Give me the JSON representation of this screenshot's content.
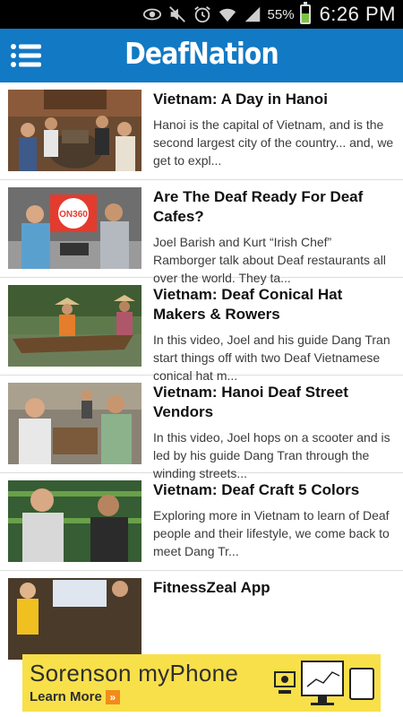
{
  "status_bar": {
    "battery_percent": "55%",
    "battery_level": 0.55,
    "time": "6:26 PM",
    "icons": [
      "eye-icon",
      "mute-icon",
      "alarm-icon",
      "wifi-icon",
      "signal-icon",
      "battery-icon"
    ]
  },
  "app_bar": {
    "title": "DeafNation",
    "menu_icon": "hamburger-menu-icon",
    "color": "#1279c4"
  },
  "articles": [
    {
      "title": "Vietnam: A Day in Hanoi",
      "description": "Hanoi is the capital of Vietnam, and is the second largest city of the country... and, we get to expl..."
    },
    {
      "title": "Are The Deaf Ready For Deaf Cafes?",
      "description": "Joel Barish and Kurt “Irish Chef” Ramborger talk about Deaf restaurants all over the world. They ta...",
      "thumb_text": "ON360"
    },
    {
      "title": "Vietnam: Deaf Conical Hat Makers & Rowers",
      "description": "In this video, Joel and his guide Dang Tran start things off with two Deaf Vietnamese conical hat m..."
    },
    {
      "title": "Vietnam: Hanoi Deaf Street Vendors",
      "description": "In this video, Joel hops on a scooter and is led by his guide Dang Tran through the winding streets..."
    },
    {
      "title": "Vietnam: Deaf Craft 5 Colors",
      "description": "Exploring more in Vietnam to learn of Deaf people and their lifestyle, we come back to meet Dang Tr..."
    },
    {
      "title": "FitnessZeal App",
      "description": ""
    }
  ],
  "ad": {
    "brand": "Sorenson myPhone",
    "cta": "Learn More",
    "cta_icon": "double-chevron-right-icon",
    "background": "#f8e04a"
  }
}
